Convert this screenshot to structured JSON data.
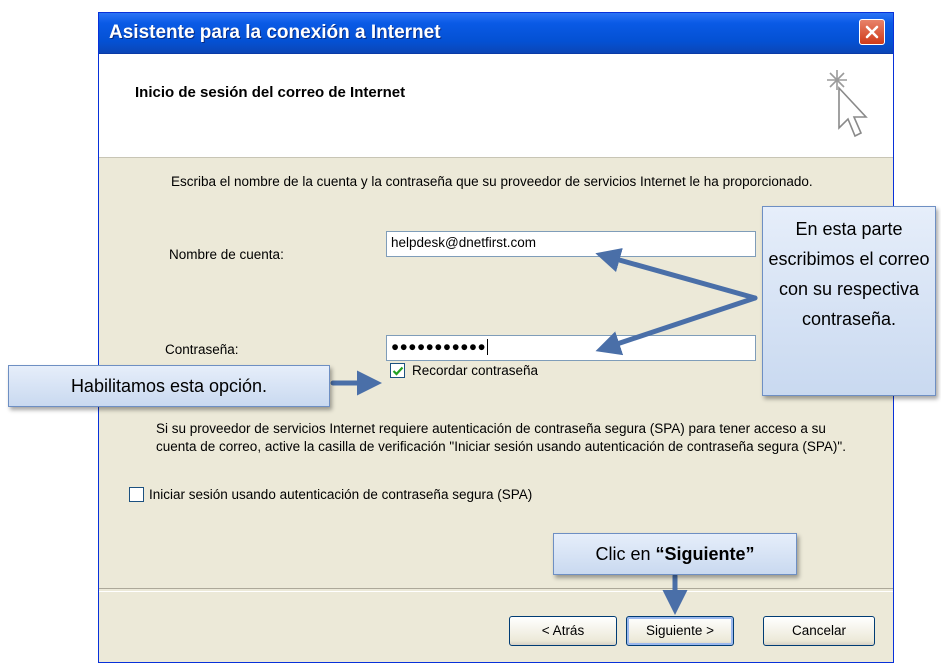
{
  "window": {
    "title": "Asistente para la conexión a Internet",
    "close_icon": "close-icon"
  },
  "header": {
    "title": "Inicio de sesión del correo de Internet",
    "icon": "wizard-sparkle-cursor-icon"
  },
  "form": {
    "intro": "Escriba el nombre de la cuenta y la contraseña que su proveedor de servicios Internet le ha proporcionado.",
    "account_label": "Nombre de cuenta:",
    "account_value": "helpdesk@dnetfirst.com",
    "password_label": "Contraseña:",
    "password_value": "●●●●●●●●●●●",
    "remember_label": "Recordar contraseña",
    "remember_checked": true,
    "spa_text": "Si su proveedor de servicios Internet requiere autenticación de contraseña segura (SPA) para tener acceso a su cuenta de correo, active la casilla de verificación \"Iniciar sesión usando autenticación de contraseña segura (SPA)\".",
    "spa_label": "Iniciar sesión usando autenticación de contraseña segura (SPA)",
    "spa_checked": false
  },
  "buttons": {
    "back": "< Atrás",
    "next": "Siguiente >",
    "cancel": "Cancelar"
  },
  "callouts": {
    "right": "En esta parte escribimos el correo con su respectiva contraseña.",
    "left": "Habilitamos esta opción.",
    "bottom_prefix": "Clic en ",
    "bottom_bold": "“Siguiente”"
  },
  "colors": {
    "titlebar": "#0a5ae6",
    "dialog_bg": "#ece9d8",
    "callout_arrow": "#4a6fa8"
  }
}
